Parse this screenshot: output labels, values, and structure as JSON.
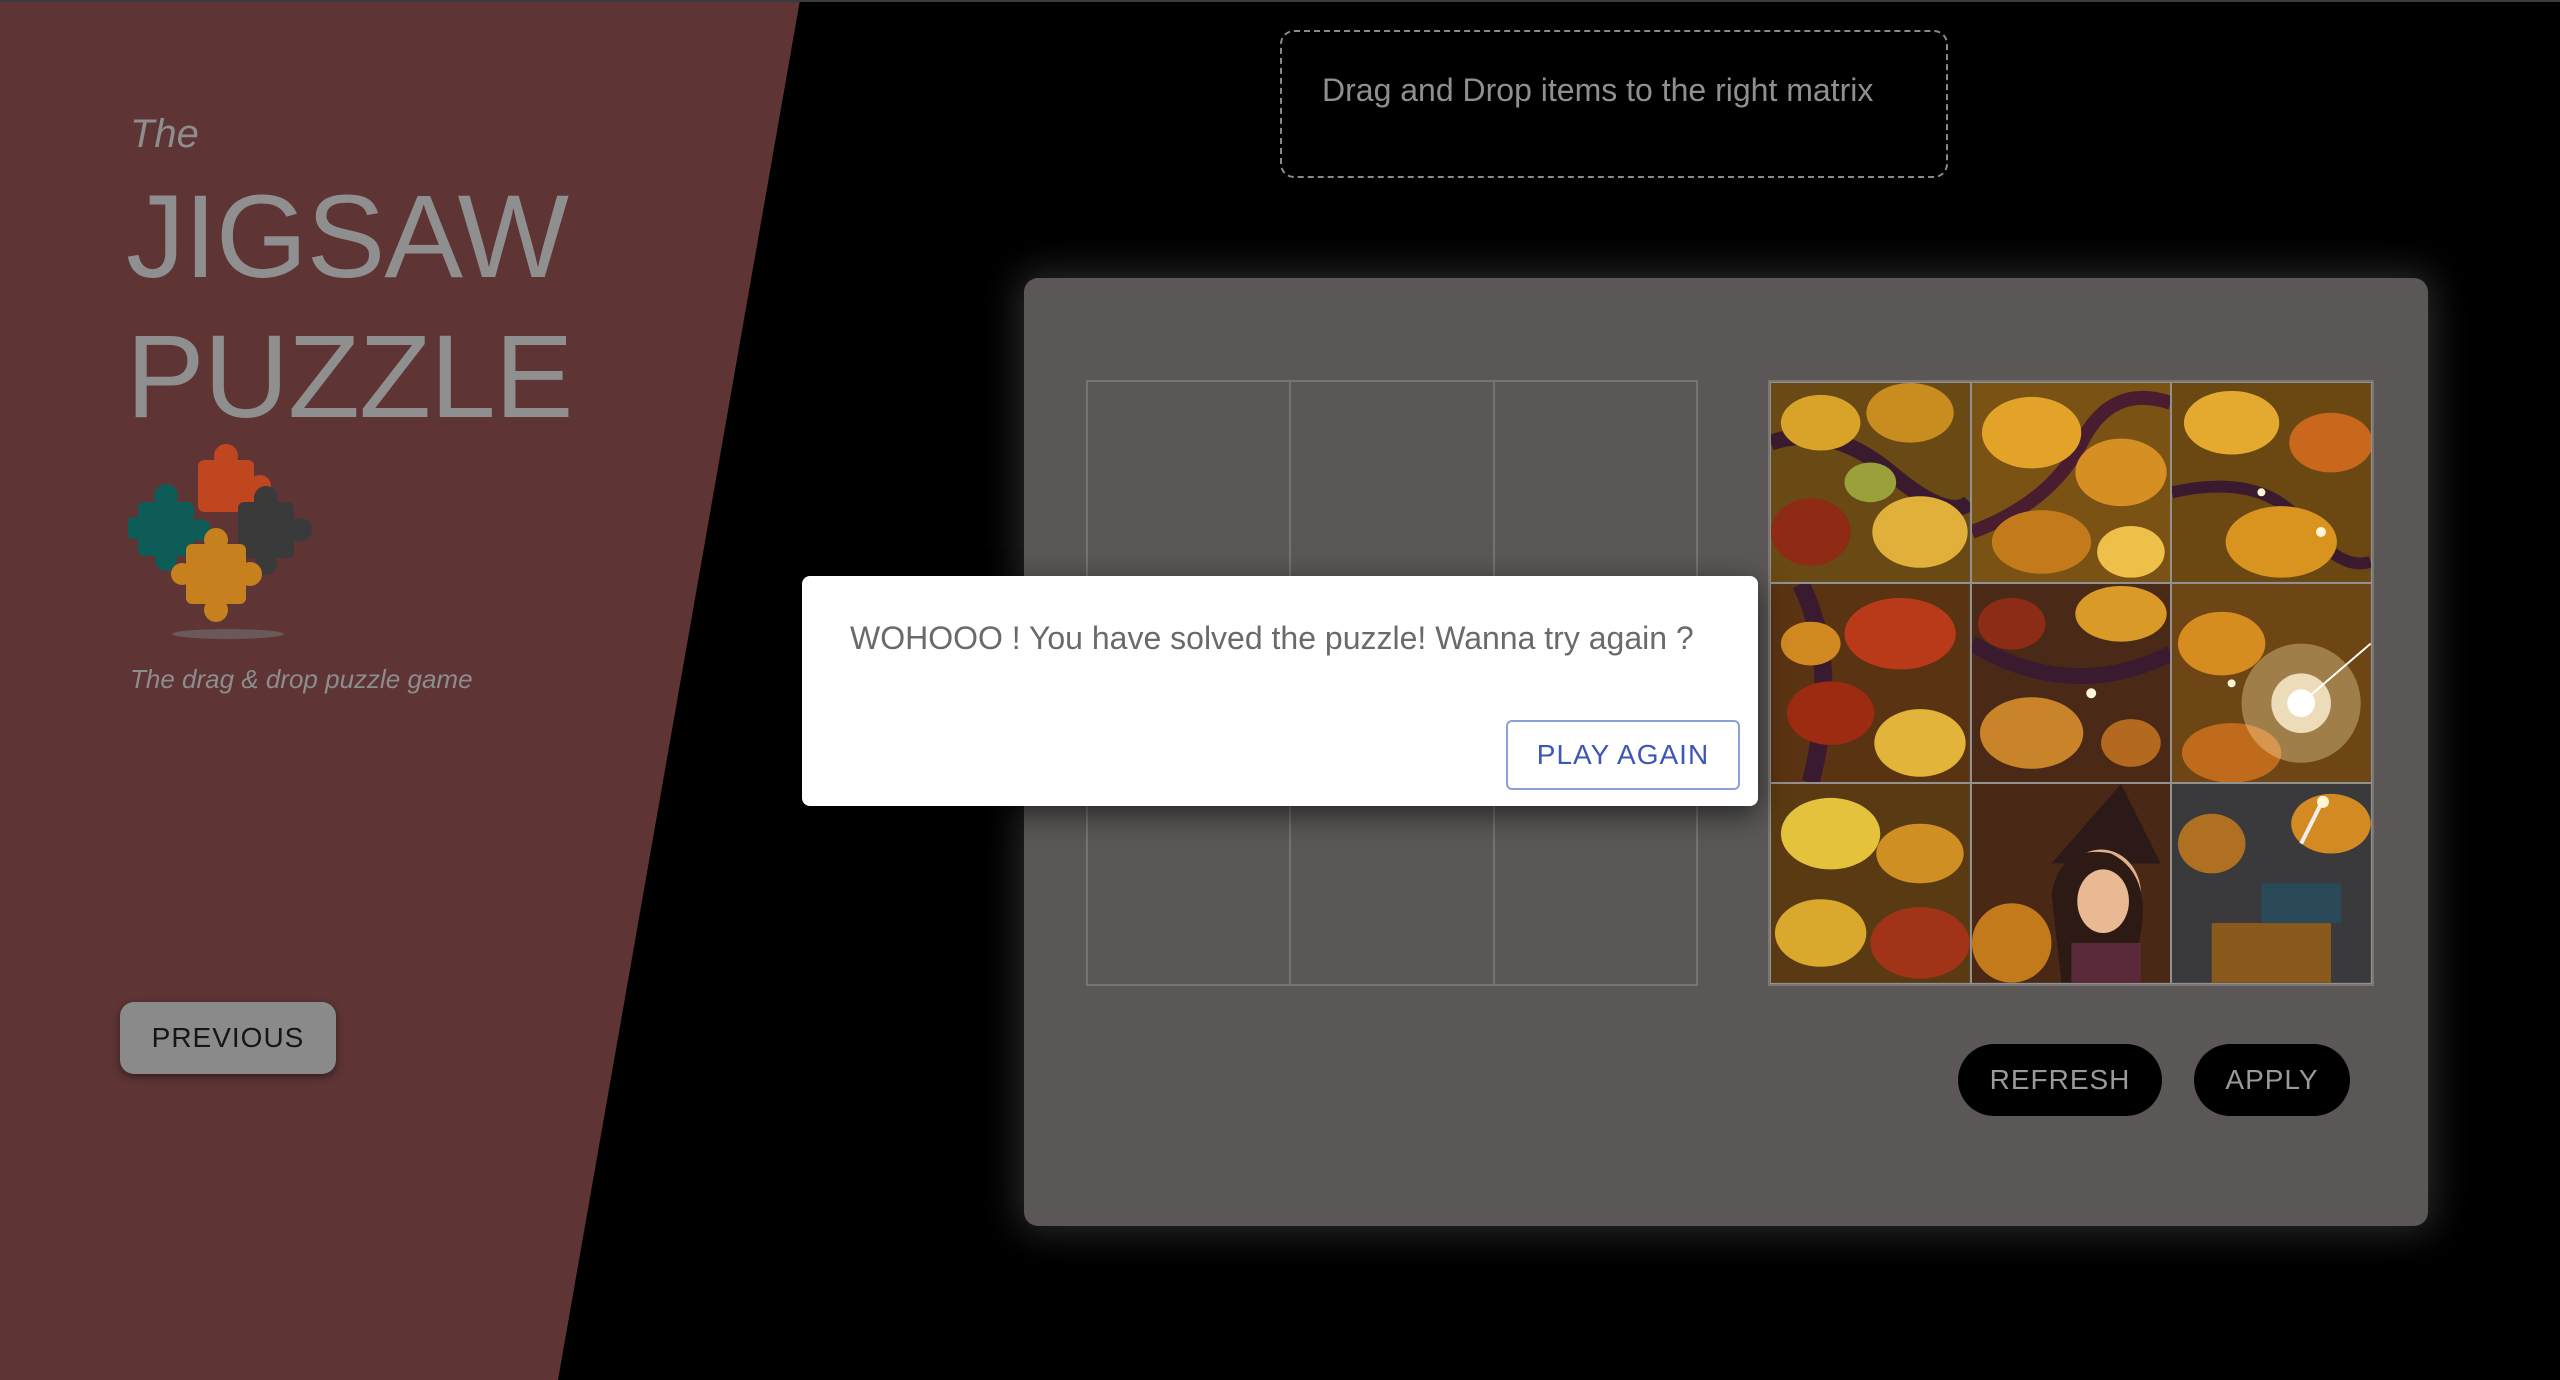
{
  "sidebar": {
    "the_label": "The",
    "title_line1": "JIGSAW",
    "title_line2": "PUZZLE",
    "tagline": "The drag & drop puzzle game",
    "previous_label": "PREVIOUS"
  },
  "instructions": "Drag and Drop items to the right matrix",
  "board": {
    "refresh_label": "REFRESH",
    "apply_label": "APPLY",
    "rows": 3,
    "cols": 3
  },
  "dialog": {
    "message": "WOHOOO ! You have solved the puzzle! Wanna try again ?",
    "play_again_label": "PLAY AGAIN"
  },
  "colors": {
    "sidebar_bg": "#5e3435",
    "board_bg": "#5b5757",
    "accent_blue": "#3e56b5",
    "piece_colors": [
      "#c0461f",
      "#0e5c57",
      "#c6811e",
      "#3a3a3a"
    ]
  },
  "icons": {
    "logo": "jigsaw-pieces-logo"
  }
}
